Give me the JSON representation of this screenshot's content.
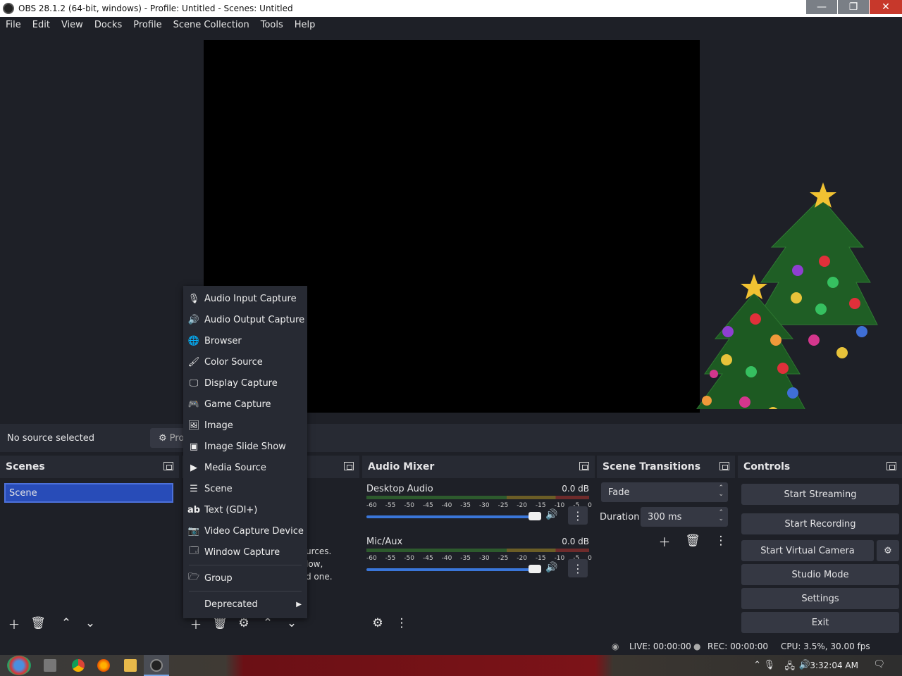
{
  "window": {
    "title": "OBS 28.1.2 (64-bit, windows) - Profile: Untitled - Scenes: Untitled",
    "min": "—",
    "max": "❐",
    "close": "✕"
  },
  "menu": [
    "File",
    "Edit",
    "View",
    "Docks",
    "Profile",
    "Scene Collection",
    "Tools",
    "Help"
  ],
  "source_bar": {
    "no_source": "No source selected",
    "properties_partial": "Pro"
  },
  "scenes": {
    "title": "Scenes",
    "items": [
      "Scene"
    ]
  },
  "sources_hint": [
    "urces.",
    "low,",
    "d one."
  ],
  "audio_mixer": {
    "title": "Audio Mixer",
    "ticks": [
      "-60",
      "-55",
      "-50",
      "-45",
      "-40",
      "-35",
      "-30",
      "-25",
      "-20",
      "-15",
      "-10",
      "-5",
      "0"
    ],
    "channels": [
      {
        "name": "Desktop Audio",
        "db": "0.0 dB"
      },
      {
        "name": "Mic/Aux",
        "db": "0.0 dB"
      }
    ]
  },
  "transitions": {
    "title": "Scene Transitions",
    "selected": "Fade",
    "duration_label": "Duration",
    "duration_value": "300 ms"
  },
  "controls": {
    "title": "Controls",
    "start_streaming": "Start Streaming",
    "start_recording": "Start Recording",
    "start_virtual_camera": "Start Virtual Camera",
    "studio_mode": "Studio Mode",
    "settings": "Settings",
    "exit": "Exit"
  },
  "status": {
    "live": "LIVE: 00:00:00",
    "rec": "REC: 00:00:00",
    "cpu": "CPU: 3.5%, 30.00 fps"
  },
  "context_menu": {
    "items": [
      {
        "label": "Audio Input Capture",
        "icon": "microphone-icon"
      },
      {
        "label": "Audio Output Capture",
        "icon": "speaker-icon"
      },
      {
        "label": "Browser",
        "icon": "globe-icon"
      },
      {
        "label": "Color Source",
        "icon": "brush-icon"
      },
      {
        "label": "Display Capture",
        "icon": "monitor-icon"
      },
      {
        "label": "Game Capture",
        "icon": "gamepad-icon"
      },
      {
        "label": "Image",
        "icon": "image-icon"
      },
      {
        "label": "Image Slide Show",
        "icon": "slideshow-icon"
      },
      {
        "label": "Media Source",
        "icon": "play-icon"
      },
      {
        "label": "Scene",
        "icon": "list-icon"
      },
      {
        "label": "Text (GDI+)",
        "icon": "text-icon"
      },
      {
        "label": "Video Capture Device",
        "icon": "camera-icon"
      },
      {
        "label": "Window Capture",
        "icon": "window-icon"
      },
      {
        "label": "Group",
        "icon": "folder-icon"
      },
      {
        "label": "Deprecated",
        "icon": "submenu-arrow-icon"
      }
    ]
  },
  "taskbar": {
    "time": "3:32:04 AM"
  }
}
